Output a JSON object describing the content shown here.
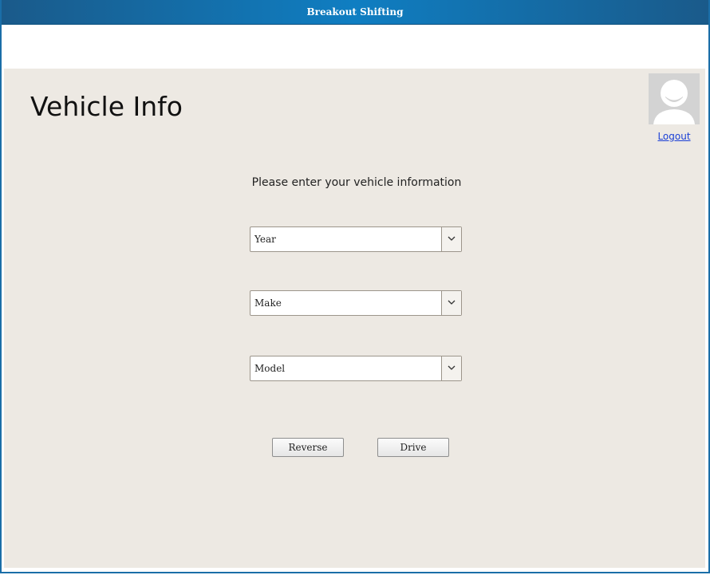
{
  "window": {
    "title": "Breakout Shifting"
  },
  "page": {
    "title": "Vehicle Info",
    "prompt": "Please enter your vehicle information"
  },
  "user": {
    "avatar_icon": "default-user-avatar",
    "logout_label": "Logout"
  },
  "form": {
    "year": {
      "value": "Year",
      "icon": "chevron-down-icon"
    },
    "make": {
      "value": "Make",
      "icon": "chevron-down-icon"
    },
    "model": {
      "value": "Model",
      "icon": "chevron-down-icon"
    }
  },
  "actions": {
    "reverse_label": "Reverse",
    "drive_label": "Drive"
  },
  "colors": {
    "titlebar": "#0f7ec2",
    "content_background": "#ede9e3",
    "link": "#1a3fd6"
  }
}
